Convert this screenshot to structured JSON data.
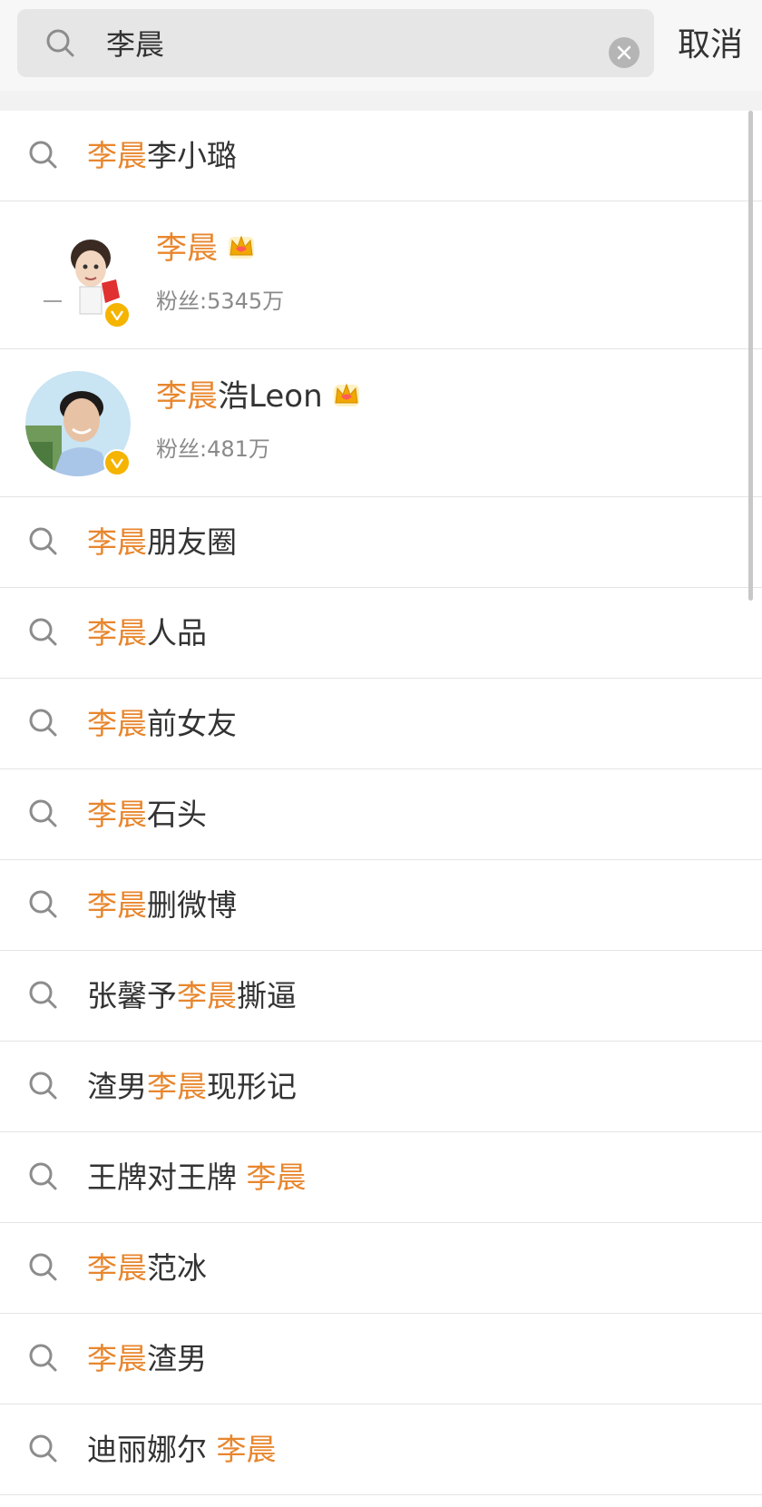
{
  "search": {
    "query": "李晨",
    "cancel_label": "取消"
  },
  "suggestions_top": [
    {
      "highlight": "李晨",
      "rest": "李小璐"
    }
  ],
  "users": [
    {
      "name_highlight": "李晨",
      "name_rest": "",
      "fans_label": "粉丝:",
      "fans_count": "5345万",
      "verified": true,
      "crown": true
    },
    {
      "name_highlight": "李晨",
      "name_rest": "浩Leon",
      "fans_label": "粉丝:",
      "fans_count": "481万",
      "verified": true,
      "crown": true
    }
  ],
  "suggestions": [
    {
      "prefix": "",
      "highlight": "李晨",
      "rest": "朋友圈"
    },
    {
      "prefix": "",
      "highlight": "李晨",
      "rest": "人品"
    },
    {
      "prefix": "",
      "highlight": "李晨",
      "rest": "前女友"
    },
    {
      "prefix": "",
      "highlight": "李晨",
      "rest": "石头"
    },
    {
      "prefix": "",
      "highlight": "李晨",
      "rest": "删微博"
    },
    {
      "prefix": "张馨予",
      "highlight": "李晨",
      "rest": "撕逼"
    },
    {
      "prefix": "渣男",
      "highlight": "李晨",
      "rest": "现形记"
    },
    {
      "prefix": "王牌对王牌 ",
      "highlight": "李晨",
      "rest": ""
    },
    {
      "prefix": "",
      "highlight": "李晨",
      "rest": "范冰"
    },
    {
      "prefix": "",
      "highlight": "李晨",
      "rest": "渣男"
    },
    {
      "prefix": "迪丽娜尔 ",
      "highlight": "李晨",
      "rest": ""
    }
  ],
  "colors": {
    "highlight": "#e8862d",
    "text": "#333333",
    "secondary": "#8a8a8a",
    "verified_badge": "#f5b400"
  },
  "icons": {
    "search": "search-icon",
    "clear": "clear-icon",
    "verified": "verified-badge-icon",
    "crown": "crown-icon"
  }
}
